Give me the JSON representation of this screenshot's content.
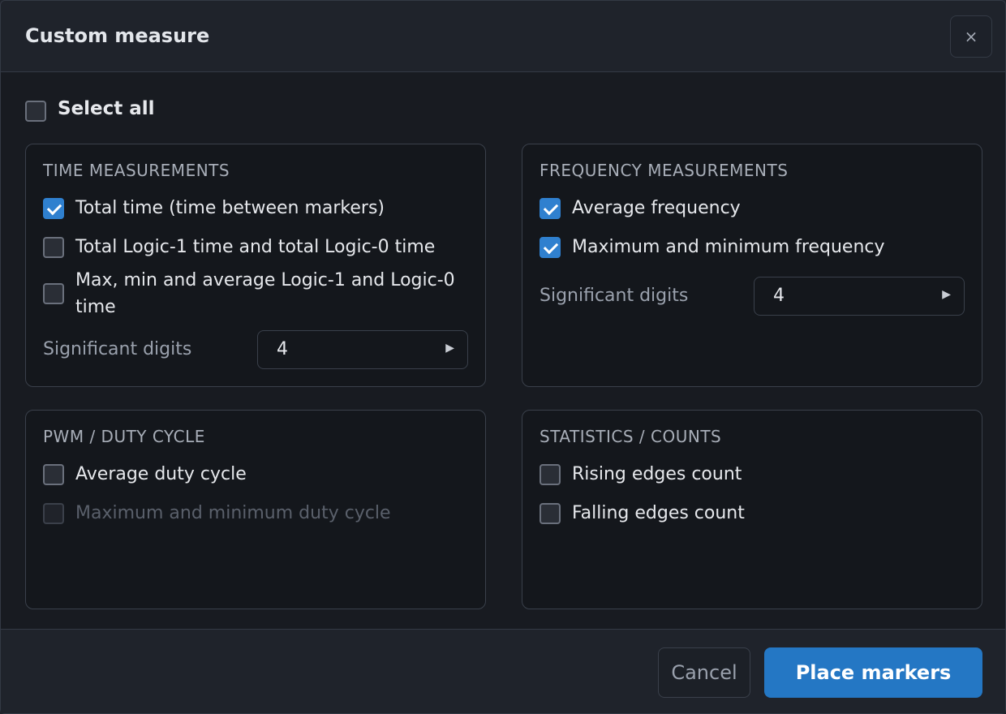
{
  "dialog": {
    "title": "Custom measure",
    "close_label": "×"
  },
  "select_all": {
    "label": "Select all",
    "checked": false
  },
  "groups": {
    "time": {
      "title": "TIME MEASUREMENTS",
      "options": [
        {
          "label": "Total time (time between markers)",
          "checked": true
        },
        {
          "label": "Total Logic-1 time and total Logic-0 time",
          "checked": false
        },
        {
          "label": "Max, min and average Logic-1 and Logic-0 time",
          "checked": false
        }
      ],
      "sig_label": "Significant digits",
      "sig_value": "4"
    },
    "frequency": {
      "title": "FREQUENCY MEASUREMENTS",
      "options": [
        {
          "label": "Average frequency",
          "checked": true
        },
        {
          "label": "Maximum and minimum frequency",
          "checked": true
        }
      ],
      "sig_label": "Significant digits",
      "sig_value": "4"
    },
    "pwm": {
      "title": "PWM / DUTY CYCLE",
      "options": [
        {
          "label": "Average duty cycle",
          "checked": false
        },
        {
          "label": "Maximum and minimum duty cycle",
          "checked": false,
          "disabled": true
        }
      ]
    },
    "stats": {
      "title": "STATISTICS / COUNTS",
      "options": [
        {
          "label": "Rising edges count",
          "checked": false
        },
        {
          "label": "Falling edges count",
          "checked": false
        }
      ]
    }
  },
  "footer": {
    "cancel_label": "Cancel",
    "primary_label": "Place markers"
  },
  "colors": {
    "accent": "#2477c4",
    "checkbox_checked": "#2f80cf",
    "background": "#1f232b",
    "panel": "#14171c"
  },
  "icons": {
    "close": "close-icon",
    "stepper_arrow": "play-arrow-icon"
  }
}
